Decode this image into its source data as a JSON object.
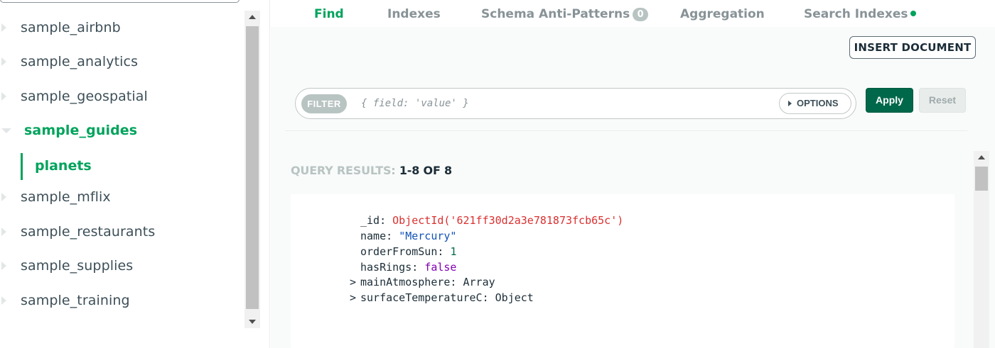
{
  "sidebar": {
    "databases": [
      {
        "label": "sample_airbnb"
      },
      {
        "label": "sample_analytics"
      },
      {
        "label": "sample_geospatial"
      },
      {
        "label": "sample_guides"
      },
      {
        "label": "sample_mflix"
      },
      {
        "label": "sample_restaurants"
      },
      {
        "label": "sample_supplies"
      },
      {
        "label": "sample_training"
      }
    ],
    "active_collection": "planets"
  },
  "tabs": {
    "find": "Find",
    "indexes": "Indexes",
    "schema": "Schema Anti-Patterns",
    "schema_badge": "0",
    "aggregation": "Aggregation",
    "search_indexes": "Search Indexes"
  },
  "toolbar": {
    "insert_document": "INSERT DOCUMENT"
  },
  "filter": {
    "pill_label": "FILTER",
    "placeholder": "{ field: 'value' }",
    "options_label": "OPTIONS",
    "apply_label": "Apply",
    "reset_label": "Reset"
  },
  "results": {
    "label": "QUERY RESULTS:",
    "count": "1-8 OF 8"
  },
  "document": {
    "id_key": "_id:",
    "id_value": "ObjectId('621ff30d2a3e781873fcb65c')",
    "name_key": "name:",
    "name_value": "\"Mercury\"",
    "order_key": "orderFromSun:",
    "order_value": "1",
    "rings_key": "hasRings:",
    "rings_value": "false",
    "atmosphere_key": "mainAtmosphere:",
    "atmosphere_value": "Array",
    "temp_key": "surfaceTemperatureC:",
    "temp_value": "Object",
    "expander_glyph": ">"
  },
  "colors": {
    "accent_green": "#00a35c",
    "apply_green": "#00684a",
    "object_id_red": "#db3030",
    "string_blue": "#1254b7",
    "boolean_purple": "#8000b4"
  }
}
